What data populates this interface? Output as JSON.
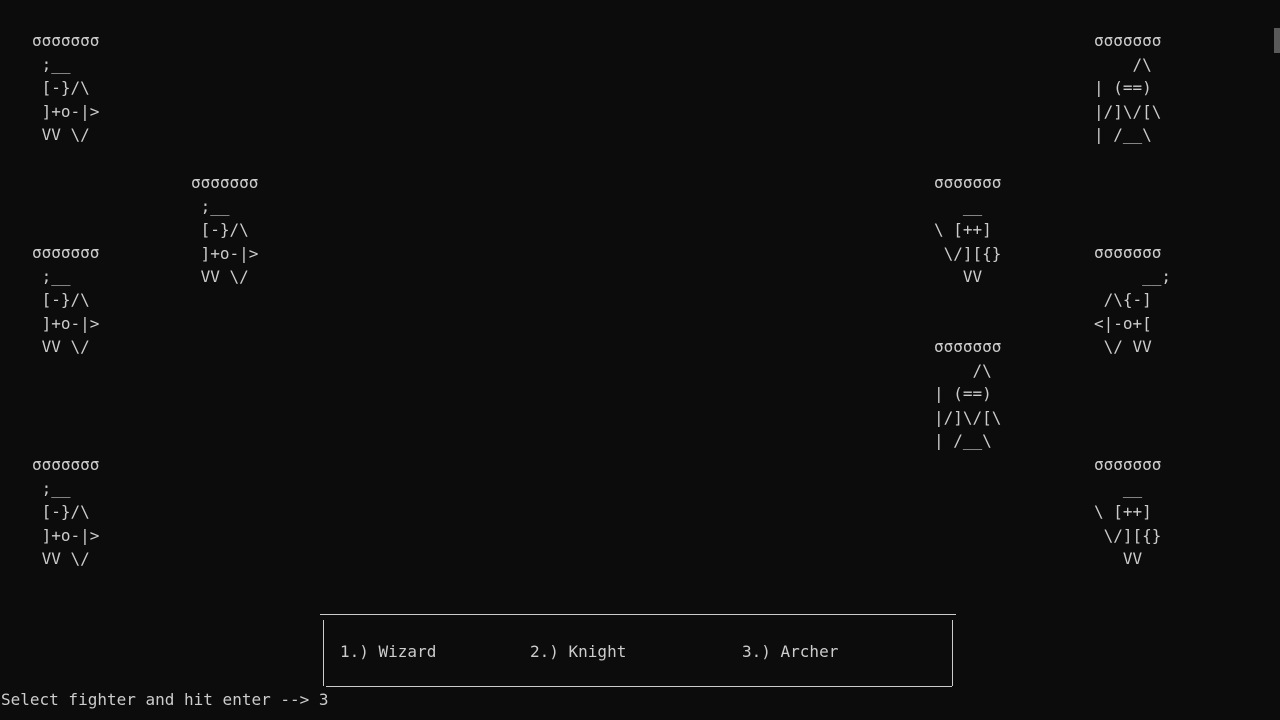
{
  "console": {
    "background": "#0c0c0c",
    "foreground": "#cccccc"
  },
  "left_team": [
    {
      "hp": "σσσσσσσ",
      "art": [
        " ;__",
        " [-}/\\",
        " ]+o-|>",
        " VV \\/"
      ]
    },
    {
      "hp": "σσσσσσσ",
      "art": [
        " ;__",
        " [-}/\\",
        " ]+o-|>",
        " VV \\/"
      ]
    },
    {
      "hp": "σσσσσσσ",
      "art": [
        " ;__",
        " [-}/\\",
        " ]+o-|>",
        " VV \\/"
      ]
    },
    {
      "hp": "σσσσσσσ",
      "art": [
        " ;__",
        " [-}/\\",
        " ]+o-|>",
        " VV \\/"
      ]
    }
  ],
  "right_team": [
    {
      "hp": "σσσσσσσ",
      "art": [
        "    /\\",
        "| (==)",
        "|/]\\/[\\",
        "| /__\\"
      ]
    },
    {
      "hp": "σσσσσσσ",
      "art": [
        "   __",
        "\\ [++]",
        " \\/][{}",
        "   VV"
      ]
    },
    {
      "hp": "σσσσσσσ",
      "art": [
        "     __;",
        " /\\{-]",
        "<|-o+[",
        " \\/ VV"
      ]
    },
    {
      "hp": "σσσσσσσ",
      "art": [
        "    /\\",
        "| (==)",
        "|/]\\/[\\",
        "| /__\\"
      ]
    },
    {
      "hp": "σσσσσσσ",
      "art": [
        "   __",
        "\\ [++]",
        " \\/][{}",
        "   VV"
      ]
    }
  ],
  "menu": {
    "options": [
      "1.) Wizard",
      "2.) Knight",
      "3.) Archer"
    ]
  },
  "prompt": {
    "label": "Select fighter and hit enter --> ",
    "input": "3"
  }
}
